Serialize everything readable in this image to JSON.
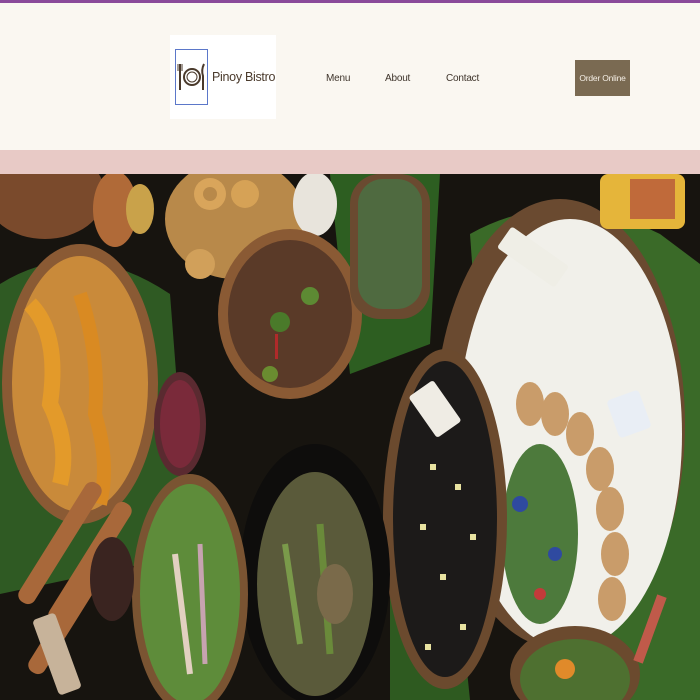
{
  "header": {
    "logo": {
      "text": "Pinoy Bistro",
      "icon": "plate-fork-knife-icon"
    },
    "nav": [
      {
        "label": "Menu"
      },
      {
        "label": "About"
      },
      {
        "label": "Contact"
      }
    ],
    "cta": {
      "label": "Order Online"
    }
  },
  "hero": {
    "image": "filipino-food-spread-photo"
  },
  "colors": {
    "accent_top_bar": "#8a4a9a",
    "header_bg": "#faf7f1",
    "band": "#e8cac6",
    "button_bg": "#7a6a52",
    "logo_border": "#5b77c9"
  }
}
